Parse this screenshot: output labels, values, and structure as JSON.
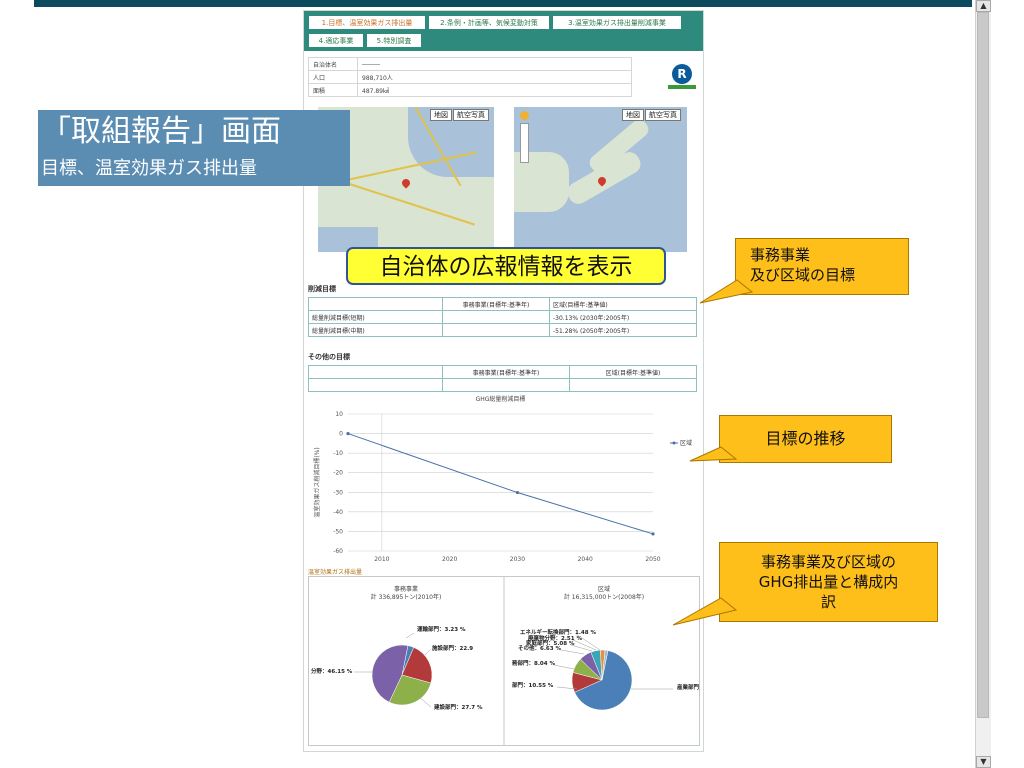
{
  "tabs": [
    {
      "label": "1.目標、温室効果ガス排出量",
      "active": true
    },
    {
      "label": "2.条例・計画等、気候変動対策",
      "active": false
    },
    {
      "label": "3.温室効果ガス排出量削減事業",
      "active": false
    },
    {
      "label": "4.適応事業",
      "active": false
    },
    {
      "label": "5.特別調査",
      "active": false
    }
  ],
  "info": {
    "rows": [
      {
        "label": "自治体名",
        "value": "―――"
      },
      {
        "label": "人口",
        "value": "988,710人"
      },
      {
        "label": "面積",
        "value": "487.89㎢"
      }
    ]
  },
  "maps": {
    "btn_map": "地図",
    "btn_aerial": "航空写真"
  },
  "goals": {
    "title": "削減目標",
    "header": [
      "",
      "事務事業(目標年:基準年)",
      "区域(目標年:基準値)"
    ],
    "rows": [
      [
        "総量削減目標(短期)",
        "",
        "-30.13% (2030年:2005年)"
      ],
      [
        "総量削減目標(中期)",
        "",
        "-51.28% (2050年:2005年)"
      ]
    ]
  },
  "other_goals": {
    "title": "その他の目標",
    "header": [
      "",
      "事務事業(目標年:基準年)",
      "区域(目標年:基準値)"
    ]
  },
  "emissions_caption": "温室効果ガス排出量",
  "overlay": {
    "title": "「取組報告」画面",
    "subtitle": "目標、温室効果ガス排出量"
  },
  "banner": "自治体の広報情報を表示",
  "callouts": {
    "c1": [
      "事務事業",
      "及び区域の目標"
    ],
    "c2": "目標の推移",
    "c3": [
      "事務事業及び区域の",
      "GHG排出量と構成内",
      "訳"
    ]
  },
  "colors": {
    "accent": "#2d8a7c",
    "callout": "#ffbf1a",
    "banner": "#ffff33",
    "overlay": "#5b8db3",
    "line": "#4a70a8"
  },
  "chart_data": [
    {
      "type": "line",
      "title": "GHG総量削減目標",
      "ylabel": "温室効果ガス削減目標(%)",
      "xlabel": "",
      "xlim": [
        2005,
        2050
      ],
      "ylim": [
        -60,
        10
      ],
      "xticks": [
        2010,
        2020,
        2030,
        2040,
        2050
      ],
      "yticks": [
        10,
        0,
        -10,
        -20,
        -30,
        -40,
        -50,
        -60
      ],
      "grid": true,
      "legend": "right",
      "series": [
        {
          "name": "区域",
          "points": [
            [
              2005,
              0
            ],
            [
              2030,
              -30.13
            ],
            [
              2050,
              -51.28
            ]
          ]
        }
      ]
    },
    {
      "type": "pie",
      "title": "事務事業",
      "subtitle": "計 336,895トン(2010年)",
      "slices": [
        {
          "label": "運輸部門",
          "value": 3.23,
          "shown": "運輸部門：3.23 %",
          "color": "#4a7fb8"
        },
        {
          "label": "施設部門",
          "value": 22.9,
          "shown": "施設部門：22.9",
          "color": "#b23a3a"
        },
        {
          "label": "建設部門",
          "value": 27.7,
          "shown": "建設部門：27.7 %",
          "color": "#8db04a"
        },
        {
          "label": "分野",
          "value": 46.15,
          "shown": "分野：46.15 %",
          "color": "#7b62a8"
        }
      ]
    },
    {
      "type": "pie",
      "title": "区域",
      "subtitle": "計 16,315,000トン(2008年)",
      "slices": [
        {
          "label": "産業部門",
          "value": 64.0,
          "shown": "産業部門：64",
          "color": "#4a7fb8"
        },
        {
          "label": "部門",
          "value": 10.55,
          "shown": "部門：10.55 %",
          "color": "#b23a3a"
        },
        {
          "label": "務部門",
          "value": 8.04,
          "shown": "務部門：8.04 %",
          "color": "#8db04a"
        },
        {
          "label": "その他",
          "value": 6.63,
          "shown": "その他：6.63 %",
          "color": "#7b62a8"
        },
        {
          "label": "家庭部門",
          "value": 5.08,
          "shown": "家庭部門：5.08 %",
          "color": "#3aa6b8"
        },
        {
          "label": "廃棄物分野",
          "value": 2.51,
          "shown": "廃棄物分野：2.51 %",
          "color": "#e8903a"
        },
        {
          "label": "エネルギー転換部門",
          "value": 1.48,
          "shown": "エネルギー転換部門：1.48 %",
          "color": "#9ab8d8"
        }
      ]
    }
  ]
}
